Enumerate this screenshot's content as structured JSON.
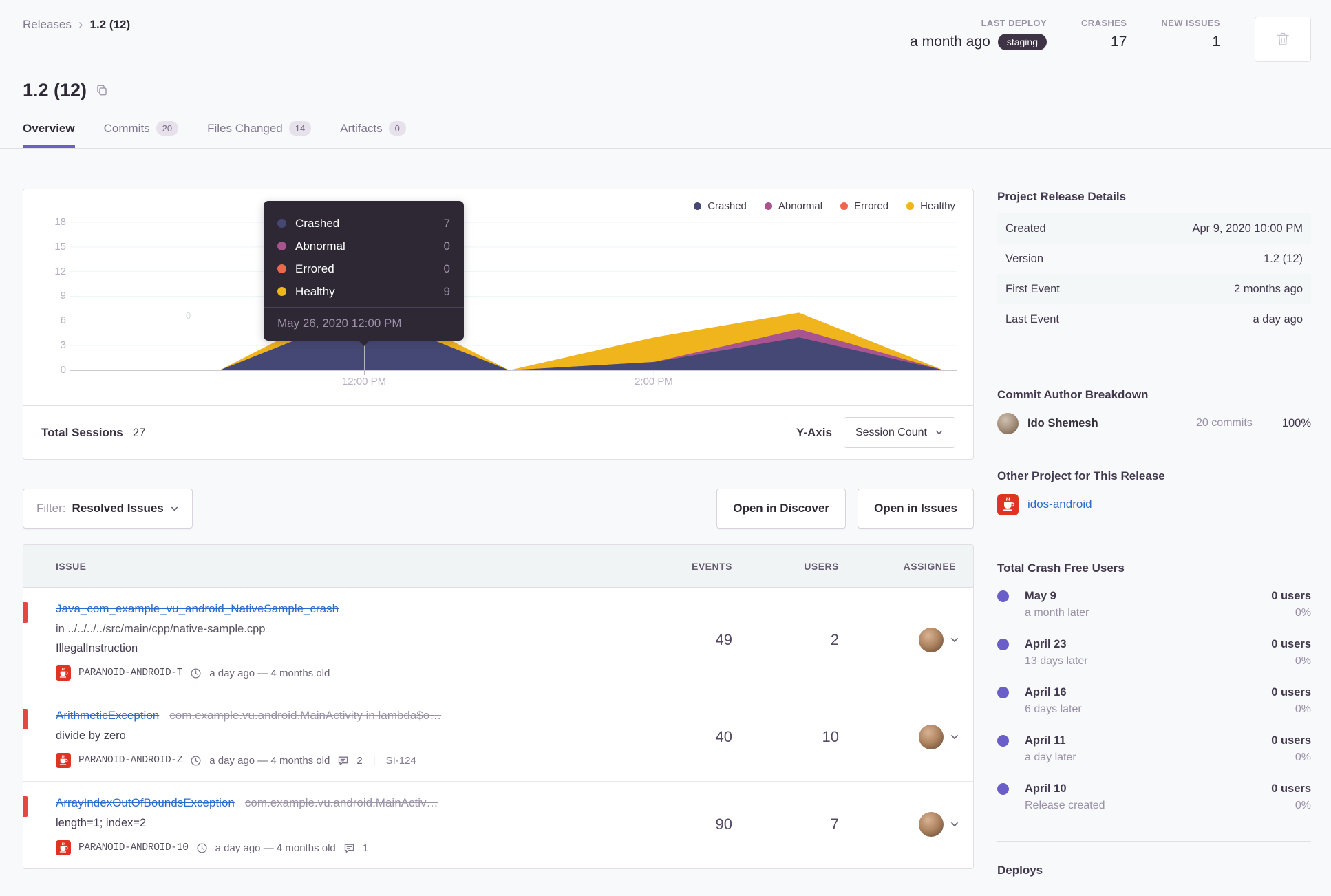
{
  "breadcrumb": {
    "parent": "Releases",
    "current": "1.2 (12)"
  },
  "header_stats": {
    "last_deploy": {
      "label": "LAST DEPLOY",
      "value": "a month ago",
      "env": "staging"
    },
    "crashes": {
      "label": "CRASHES",
      "value": "17"
    },
    "new_issues": {
      "label": "NEW ISSUES",
      "value": "1"
    }
  },
  "title": "1.2 (12)",
  "tabs": [
    {
      "label": "Overview"
    },
    {
      "label": "Commits",
      "badge": "20"
    },
    {
      "label": "Files Changed",
      "badge": "14"
    },
    {
      "label": "Artifacts",
      "badge": "0"
    }
  ],
  "chart_data": {
    "type": "area",
    "x": [
      "10:00 AM",
      "11:00 AM",
      "12:00 PM",
      "1:00 PM",
      "2:00 PM",
      "3:00 PM",
      "4:00 PM"
    ],
    "series": [
      {
        "name": "Crashed",
        "color": "#454874",
        "values": [
          0,
          0,
          7,
          0,
          1,
          4,
          0
        ]
      },
      {
        "name": "Abnormal",
        "color": "#a7548f",
        "values": [
          0,
          0,
          0,
          0,
          1,
          5,
          0
        ]
      },
      {
        "name": "Errored",
        "color": "#e9684e",
        "values": [
          0,
          0,
          0,
          0,
          0,
          0,
          0
        ]
      },
      {
        "name": "Healthy",
        "color": "#f0b41c",
        "values": [
          0,
          0,
          9,
          0,
          4,
          7,
          0
        ]
      }
    ],
    "ylim": [
      0,
      18
    ],
    "y_ticks": [
      0,
      3,
      6,
      9,
      12,
      15,
      18
    ],
    "x_ticks_shown": [
      "12:00 PM",
      "2:00 PM"
    ],
    "legend_position": "top-right",
    "grid": true,
    "stray_label": "0",
    "total_sessions": 27,
    "tooltip": {
      "rows": [
        {
          "label": "Crashed",
          "value": 7
        },
        {
          "label": "Abnormal",
          "value": 0
        },
        {
          "label": "Errored",
          "value": 0
        },
        {
          "label": "Healthy",
          "value": 9
        }
      ],
      "footer": "May 26, 2020 12:00 PM"
    }
  },
  "chart_footer": {
    "total_label": "Total Sessions",
    "total_value": "27",
    "y_axis_label": "Y-Axis",
    "y_axis_value": "Session Count"
  },
  "issues_toolbar": {
    "filter_label": "Filter:",
    "filter_value": "Resolved Issues",
    "open_discover": "Open in Discover",
    "open_issues": "Open in Issues"
  },
  "issues_table": {
    "columns": [
      "ISSUE",
      "EVENTS",
      "USERS",
      "ASSIGNEE"
    ],
    "rows": [
      {
        "title": "Java_com_example_vu_android_NativeSample_crash",
        "culprit": "",
        "location": "in ../../../../src/main/cpp/native-sample.cpp",
        "message": "IllegalInstruction",
        "project": "PARANOID-ANDROID-T",
        "age": "a day ago — 4 months old",
        "comments": "",
        "short_id": "",
        "events": "49",
        "users": "2"
      },
      {
        "title": "ArithmeticException",
        "culprit": "com.example.vu.android.MainActivity in lambda$o…",
        "location": "",
        "message": "divide by zero",
        "project": "PARANOID-ANDROID-Z",
        "age": "a day ago — 4 months old",
        "comments": "2",
        "short_id": "SI-124",
        "events": "40",
        "users": "10"
      },
      {
        "title": "ArrayIndexOutOfBoundsException",
        "culprit": "com.example.vu.android.MainActiv…",
        "location": "",
        "message": "length=1; index=2",
        "project": "PARANOID-ANDROID-10",
        "age": "a day ago — 4 months old",
        "comments": "1",
        "short_id": "",
        "events": "90",
        "users": "7"
      }
    ]
  },
  "sidebar": {
    "release_details": {
      "heading": "Project Release Details",
      "rows": [
        {
          "label": "Created",
          "value": "Apr 9, 2020 10:00 PM"
        },
        {
          "label": "Version",
          "value": "1.2 (12)"
        },
        {
          "label": "First Event",
          "value": "2 months ago"
        },
        {
          "label": "Last Event",
          "value": "a day ago"
        }
      ]
    },
    "commit_authors": {
      "heading": "Commit Author Breakdown",
      "author": {
        "name": "Ido Shemesh",
        "commits": "20 commits",
        "percent": "100%"
      }
    },
    "other_project": {
      "heading": "Other Project for This Release",
      "project": "idos-android"
    },
    "crash_free": {
      "heading": "Total Crash Free Users",
      "entries": [
        {
          "date": "May 9",
          "sub": "a month later",
          "users": "0 users",
          "percent": "0%"
        },
        {
          "date": "April 23",
          "sub": "13 days later",
          "users": "0 users",
          "percent": "0%"
        },
        {
          "date": "April 16",
          "sub": "6 days later",
          "users": "0 users",
          "percent": "0%"
        },
        {
          "date": "April 11",
          "sub": "a day later",
          "users": "0 users",
          "percent": "0%"
        },
        {
          "date": "April 10",
          "sub": "Release created",
          "users": "0 users",
          "percent": "0%"
        }
      ]
    },
    "deploys_heading": "Deploys"
  },
  "colors": {
    "accent_purple": "#6c5fc7",
    "link_blue": "#2c6dca",
    "level_red": "#e6483d",
    "tooltip_bg": "#2e2834",
    "env_pill_bg": "#3e3446"
  }
}
